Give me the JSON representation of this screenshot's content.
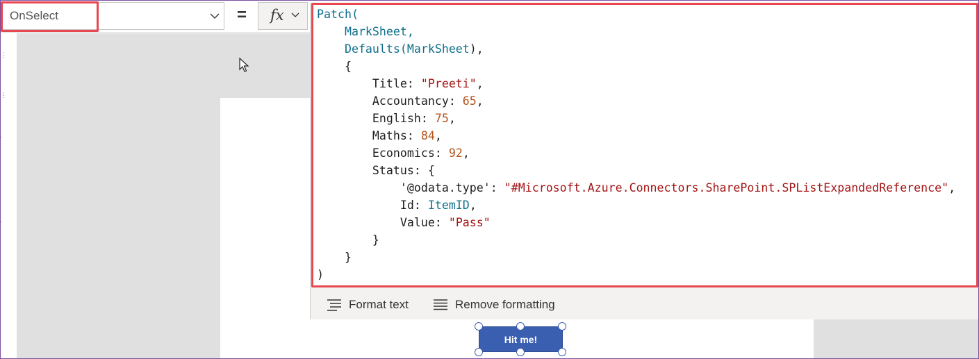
{
  "formula_bar": {
    "property": "OnSelect",
    "equals": "=",
    "fx_label": "fx"
  },
  "code": {
    "lines": [
      [
        {
          "t": "Patch(",
          "k": "fn"
        }
      ],
      [
        {
          "t": "    MarkSheet,",
          "k": "id"
        }
      ],
      [
        {
          "t": "    Defaults(",
          "k": "fn"
        },
        {
          "t": "MarkSheet",
          "k": "id"
        },
        {
          "t": "),",
          "k": "p"
        }
      ],
      [
        {
          "t": "    {",
          "k": "p"
        }
      ],
      [
        {
          "t": "        Title: ",
          "k": "p"
        },
        {
          "t": "\"Preeti\"",
          "k": "str"
        },
        {
          "t": ",",
          "k": "p"
        }
      ],
      [
        {
          "t": "        Accountancy: ",
          "k": "p"
        },
        {
          "t": "65",
          "k": "num"
        },
        {
          "t": ",",
          "k": "p"
        }
      ],
      [
        {
          "t": "        English: ",
          "k": "p"
        },
        {
          "t": "75",
          "k": "num"
        },
        {
          "t": ",",
          "k": "p"
        }
      ],
      [
        {
          "t": "        Maths: ",
          "k": "p"
        },
        {
          "t": "84",
          "k": "num"
        },
        {
          "t": ",",
          "k": "p"
        }
      ],
      [
        {
          "t": "        Economics: ",
          "k": "p"
        },
        {
          "t": "92",
          "k": "num"
        },
        {
          "t": ",",
          "k": "p"
        }
      ],
      [
        {
          "t": "        Status: {",
          "k": "p"
        }
      ],
      [
        {
          "t": "            '@odata.type': ",
          "k": "p"
        },
        {
          "t": "\"#Microsoft.Azure.Connectors.SharePoint.SPListExpandedReference\"",
          "k": "str"
        },
        {
          "t": ",",
          "k": "p"
        }
      ],
      [
        {
          "t": "            Id: ",
          "k": "p"
        },
        {
          "t": "ItemID",
          "k": "id"
        },
        {
          "t": ",",
          "k": "p"
        }
      ],
      [
        {
          "t": "            Value: ",
          "k": "p"
        },
        {
          "t": "\"Pass\"",
          "k": "str"
        }
      ],
      [
        {
          "t": "        }",
          "k": "p"
        }
      ],
      [
        {
          "t": "    }",
          "k": "p"
        }
      ],
      [
        {
          "t": ")",
          "k": "p"
        }
      ]
    ]
  },
  "editor_toolbar": {
    "format_text": "Format text",
    "remove_formatting": "Remove formatting"
  },
  "canvas": {
    "button_label": "Hit me!"
  },
  "colors": {
    "highlight": "#e8474f",
    "button": "#3a5eb0",
    "keyword": "#0e6f8c",
    "string": "#a31515",
    "number": "#b5541b"
  }
}
